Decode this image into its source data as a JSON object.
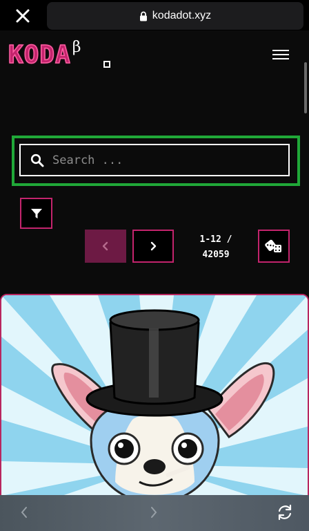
{
  "browser": {
    "url": "kodadot.xyz",
    "close_icon": "close-icon",
    "lock_icon": "lock-icon",
    "back_icon": "chevron-left-icon",
    "forward_icon": "chevron-right-icon",
    "reload_icon": "reload-icon"
  },
  "header": {
    "logo_text": "KODA",
    "logo_beta": "β",
    "menu_icon": "hamburger-menu-icon"
  },
  "search": {
    "placeholder": "Search ...",
    "value": "",
    "icon": "search-icon",
    "highlight_color": "#20a838"
  },
  "toolbar": {
    "filter_icon": "filter-icon",
    "prev_icon": "chevron-left-icon",
    "next_icon": "chevron-right-icon",
    "range_line1": "1-12 /",
    "range_line2": "42059",
    "random_icon": "dice-icon"
  },
  "gallery": {
    "first_item": "chihuahua-top-hat-nft-image"
  },
  "colors": {
    "accent": "#c4246d",
    "accent_dark": "#6d1a44",
    "background": "#0b0b0b"
  }
}
